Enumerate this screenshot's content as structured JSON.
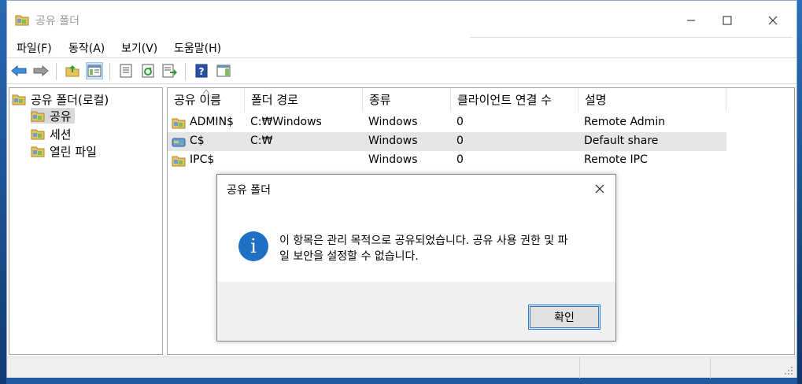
{
  "window": {
    "title": "공유 폴더"
  },
  "menubar": [
    "파일(F)",
    "동작(A)",
    "보기(V)",
    "도움말(H)"
  ],
  "toolbar": [
    {
      "icon": "back-arrow-icon"
    },
    {
      "icon": "forward-arrow-icon"
    },
    {
      "icon": "up-folder-icon"
    },
    {
      "icon": "show-hide-tree-icon",
      "active": true
    },
    {
      "icon": "properties-icon"
    },
    {
      "icon": "refresh-icon"
    },
    {
      "icon": "export-list-icon"
    },
    {
      "icon": "help-icon"
    },
    {
      "icon": "show-hide-action-pane-icon"
    }
  ],
  "tree": {
    "root": "공유 폴더(로컬)",
    "children": [
      "공유",
      "세션",
      "열린 파일"
    ],
    "selected": "공유"
  },
  "list": {
    "columns": [
      "공유 이름",
      "폴더 경로",
      "종류",
      "클라이언트 연결 수",
      "설명"
    ],
    "rows": [
      {
        "name": "ADMIN$",
        "path": "C:₩Windows",
        "type": "Windows",
        "clients": "0",
        "desc": "Remote Admin"
      },
      {
        "name": "C$",
        "path": "C:₩",
        "type": "Windows",
        "clients": "0",
        "desc": "Default share",
        "selected": true
      },
      {
        "name": "IPC$",
        "path": "",
        "type": "Windows",
        "clients": "0",
        "desc": "Remote IPC"
      }
    ]
  },
  "dialog": {
    "title": "공유 폴더",
    "icon": "info-icon",
    "message_line1": "이 항목은 관리 목적으로 공유되었습니다. 공유 사용 권한 및 파",
    "message_line2": "일 보안을 설정할 수 없습니다.",
    "ok_label": "확인"
  },
  "colors": {
    "accent": "#1f6fc5",
    "folder": "#e8c25a",
    "selection": "#e5e5e5"
  }
}
